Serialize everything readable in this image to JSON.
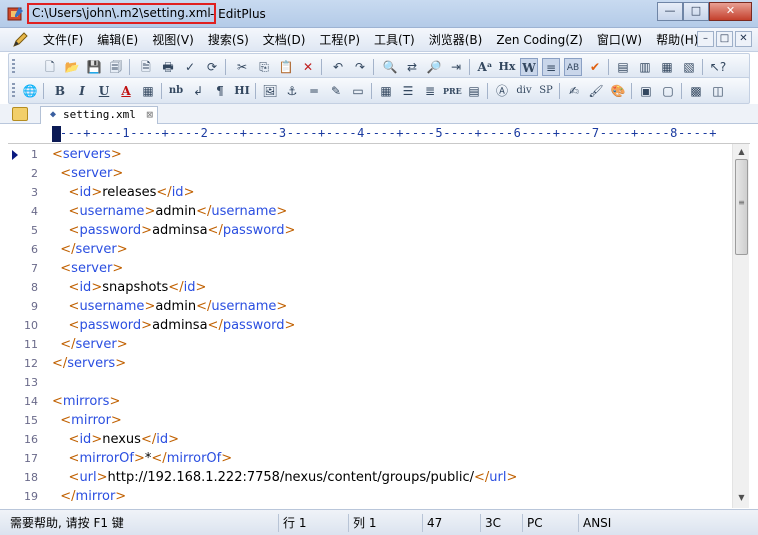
{
  "window": {
    "path": "C:\\Users\\john\\.m2\\setting.xml",
    "app_name": "- EditPlus",
    "minimize": "—",
    "maximize": "□",
    "close": "✕"
  },
  "menu": {
    "items": [
      "文件(F)",
      "编辑(E)",
      "视图(V)",
      "搜索(S)",
      "文档(D)",
      "工程(P)",
      "工具(T)",
      "浏览器(B)",
      "Zen Coding(Z)",
      "窗口(W)",
      "帮助(H)"
    ],
    "mdi": [
      "–",
      "□",
      "✕"
    ]
  },
  "toolbar2_text": {
    "bold": "B",
    "italic": "I",
    "underline": "U",
    "font_color": "A",
    "nb": "nb",
    "pilcrow": "¶",
    "heading": "H",
    "hi": "HI",
    "pre": "PRE",
    "div": "div",
    "sp": "SP",
    "hx": "Hx",
    "w": "W"
  },
  "tab": {
    "label": "setting.xml",
    "glyph": "◆",
    "close": "⊠"
  },
  "ruler": {
    "text": "----+----1----+----2----+----3----+----4----+----5----+----6----+----7----+----8----+"
  },
  "editor": {
    "lines": [
      {
        "n": "1",
        "indent": "",
        "tag": "servers",
        "value": null,
        "kind": "open"
      },
      {
        "n": "2",
        "indent": "  ",
        "tag": "server",
        "value": null,
        "kind": "open"
      },
      {
        "n": "3",
        "indent": "    ",
        "tag": "id",
        "value": "releases",
        "kind": "inline"
      },
      {
        "n": "4",
        "indent": "    ",
        "tag": "username",
        "value": "admin",
        "kind": "inline"
      },
      {
        "n": "5",
        "indent": "    ",
        "tag": "password",
        "value": "adminsa",
        "kind": "inline"
      },
      {
        "n": "6",
        "indent": "  ",
        "tag": "server",
        "value": null,
        "kind": "close"
      },
      {
        "n": "7",
        "indent": "  ",
        "tag": "server",
        "value": null,
        "kind": "open"
      },
      {
        "n": "8",
        "indent": "    ",
        "tag": "id",
        "value": "snapshots",
        "kind": "inline"
      },
      {
        "n": "9",
        "indent": "    ",
        "tag": "username",
        "value": "admin",
        "kind": "inline"
      },
      {
        "n": "10",
        "indent": "    ",
        "tag": "password",
        "value": "adminsa",
        "kind": "inline"
      },
      {
        "n": "11",
        "indent": "  ",
        "tag": "server",
        "value": null,
        "kind": "close"
      },
      {
        "n": "12",
        "indent": "",
        "tag": "servers",
        "value": null,
        "kind": "close"
      },
      {
        "n": "13",
        "indent": "",
        "tag": null,
        "value": null,
        "kind": "blank"
      },
      {
        "n": "14",
        "indent": "",
        "tag": "mirrors",
        "value": null,
        "kind": "open"
      },
      {
        "n": "15",
        "indent": "  ",
        "tag": "mirror",
        "value": null,
        "kind": "open"
      },
      {
        "n": "16",
        "indent": "    ",
        "tag": "id",
        "value": "nexus",
        "kind": "inline"
      },
      {
        "n": "17",
        "indent": "    ",
        "tag": "mirrorOf",
        "value": "*",
        "kind": "inline"
      },
      {
        "n": "18",
        "indent": "    ",
        "tag": "url",
        "value": "http://192.168.1.222:7758/nexus/content/groups/public/",
        "kind": "inline"
      },
      {
        "n": "19",
        "indent": "  ",
        "tag": "mirror",
        "value": null,
        "kind": "close"
      }
    ]
  },
  "scrollbar": {
    "up": "▲",
    "down": "▼",
    "grip": "≡"
  },
  "status": {
    "help": "需要帮助, 请按 F1 键",
    "line": "行 1",
    "col": "列 1",
    "count": "47",
    "hex": "3C",
    "mode": "PC",
    "encoding": "ANSI"
  },
  "colors": {
    "tag": "#2a4ee0",
    "bracket": "#c06000",
    "highlight_border": "#e02020"
  }
}
